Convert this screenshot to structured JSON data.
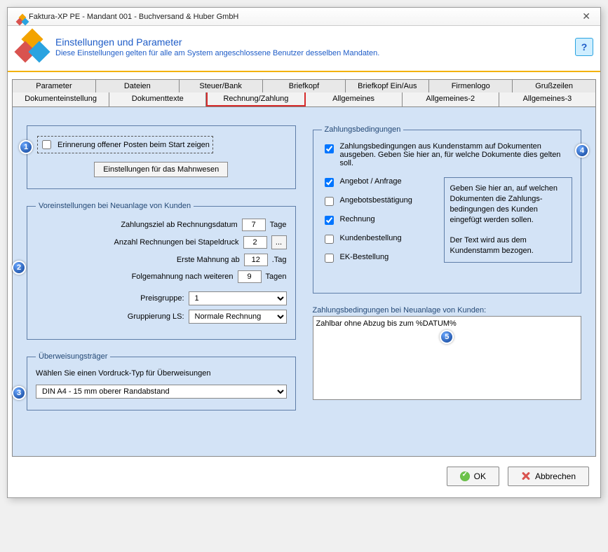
{
  "window": {
    "title": "Faktura-XP PE - Mandant 001 - Buchversand & Huber GmbH"
  },
  "header": {
    "title": "Einstellungen und Parameter",
    "subtitle": "Diese Einstellungen gelten für alle am System angeschlossene Benutzer desselben Mandaten."
  },
  "tabs_row1": [
    "Parameter",
    "Dateien",
    "Steuer/Bank",
    "Briefkopf",
    "Briefkopf Ein/Aus",
    "Firmenlogo",
    "Grußzeilen"
  ],
  "tabs_row2": [
    "Dokumenteinstellung",
    "Dokumenttexte",
    "Rechnung/Zahlung",
    "Allgemeines",
    "Allgemeines-2",
    "Allgemeines-3"
  ],
  "active_tab": "Rechnung/Zahlung",
  "reminder": {
    "checkbox_label": "Erinnerung offener Posten beim Start zeigen",
    "button_label": "Einstellungen für das Mahnwesen"
  },
  "voreinst": {
    "legend": "Voreinstellungen bei Neuanlage von Kunden",
    "zahlungsziel_label": "Zahlungsziel ab Rechnungsdatum",
    "zahlungsziel_value": "7",
    "zahlungsziel_unit": "Tage",
    "stapel_label": "Anzahl Rechnungen bei Stapeldruck",
    "stapel_value": "2",
    "erste_mahnung_label": "Erste Mahnung ab",
    "erste_mahnung_value": "12",
    "erste_mahnung_unit": ".Tag",
    "folge_label": "Folgemahnung nach weiteren",
    "folge_value": "9",
    "folge_unit": "Tagen",
    "preisgruppe_label": "Preisgruppe:",
    "preisgruppe_value": "1",
    "grupp_label": "Gruppierung LS:",
    "grupp_value": "Normale Rechnung"
  },
  "ueberw": {
    "legend": "Überweisungsträger",
    "text": "Wählen Sie einen Vordruck-Typ für Überweisungen",
    "value": "DIN A4 - 15 mm oberer Randabstand"
  },
  "zb": {
    "legend": "Zahlungsbedingungen",
    "top_text": "Zahlungsbedingungen aus Kundenstamm auf Dokumenten ausgeben. Geben Sie hier an, für welche Dokumente dies gelten soll.",
    "opts": {
      "angebot": "Angebot / Anfrage",
      "angebotsbest": "Angebotsbestätigung",
      "rechnung": "Rechnung",
      "kundenbest": "Kundenbestellung",
      "ekbest": "EK-Bestellung"
    },
    "info": "Geben Sie hier an, auf welchen Dokumenten die Zahlungs-bedingungen des Kunden eingefügt werden sollen.\n\nDer Text wird aus dem Kundenstamm bezogen.",
    "neu_label": "Zahlungsbedingungen bei Neuanlage von Kunden:",
    "neu_text": "Zahlbar ohne Abzug bis zum %DATUM%"
  },
  "footer": {
    "ok": "OK",
    "cancel": "Abbrechen"
  },
  "callouts": {
    "c1": "1",
    "c2": "2",
    "c3": "3",
    "c4": "4",
    "c5": "5"
  }
}
